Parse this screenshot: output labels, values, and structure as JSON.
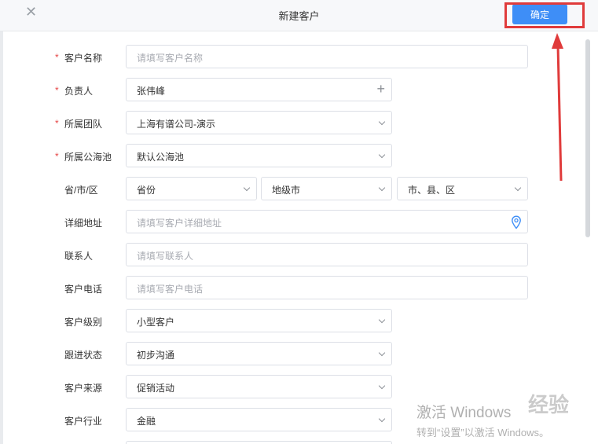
{
  "dialog": {
    "title": "新建客户",
    "confirm_label": "确定",
    "close_glyph": "✕"
  },
  "form": {
    "customer_name": {
      "label": "客户名称",
      "placeholder": "请填写客户名称",
      "required": "*"
    },
    "owner": {
      "label": "负责人",
      "value": "张伟峰",
      "required": "*",
      "add_glyph": "+"
    },
    "team": {
      "label": "所属团队",
      "value": "上海有谱公司-演示",
      "required": "*"
    },
    "pool": {
      "label": "所属公海池",
      "value": "默认公海池",
      "required": "*"
    },
    "region": {
      "label": "省/市/区",
      "province": "省份",
      "city": "地级市",
      "district": "市、县、区"
    },
    "address": {
      "label": "详细地址",
      "placeholder": "请填写客户详细地址"
    },
    "contact": {
      "label": "联系人",
      "placeholder": "请填写联系人"
    },
    "phone": {
      "label": "客户电话",
      "placeholder": "请填写客户电话"
    },
    "level": {
      "label": "客户级别",
      "value": "小型客户"
    },
    "status": {
      "label": "跟进状态",
      "value": "初步沟通"
    },
    "source": {
      "label": "客户来源",
      "value": "促销活动"
    },
    "industry": {
      "label": "客户行业",
      "value": "金融"
    }
  },
  "watermark": {
    "line1": "激活 Windows",
    "line2": "转到“设置”以激活 Windows。"
  },
  "brand": "经验",
  "colors": {
    "accent": "#3e8ef7",
    "required": "#e64545",
    "annotation": "#e03b3b"
  },
  "icons": [
    "close-icon",
    "plus-icon",
    "chevron-down-icon",
    "location-pin-icon"
  ]
}
